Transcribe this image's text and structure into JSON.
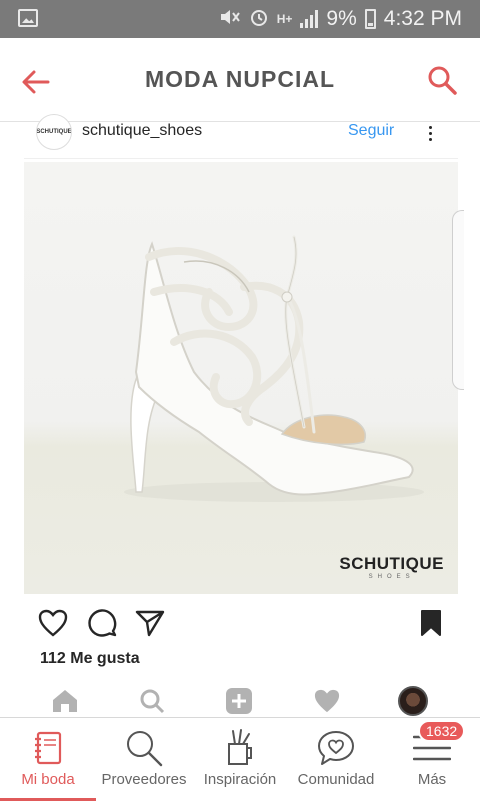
{
  "status_bar": {
    "battery": "9%",
    "time": "4:32 PM",
    "network": "H+"
  },
  "app_bar": {
    "title": "MODA NUPCIAL"
  },
  "post": {
    "username": "schutique_shoes",
    "follow_label": "Seguir",
    "avatar_text": "SCHUTIQUE",
    "brand_name": "SCHUTIQUE",
    "brand_sub": "SHOES",
    "likes": "112 Me gusta"
  },
  "bottom_nav": {
    "items": [
      {
        "label": "Mi boda",
        "icon": "notebook-icon"
      },
      {
        "label": "Proveedores",
        "icon": "search-icon"
      },
      {
        "label": "Inspiración",
        "icon": "inspiration-icon"
      },
      {
        "label": "Comunidad",
        "icon": "chat-heart-icon"
      },
      {
        "label": "Más",
        "icon": "menu-icon"
      }
    ],
    "badge": "1632"
  },
  "colors": {
    "accent": "#e05a5a",
    "status_bar": "#7a7a7a",
    "link_blue": "#3897f0"
  }
}
